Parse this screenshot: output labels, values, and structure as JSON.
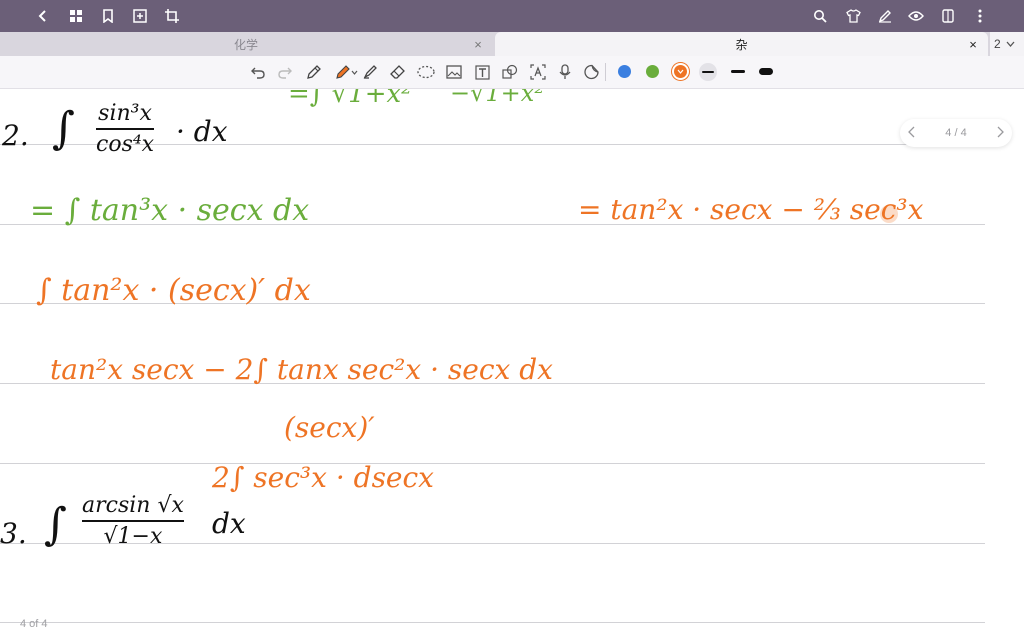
{
  "colors": {
    "topbar": "#6b5f78",
    "ink_black": "#111111",
    "ink_green": "#6aad3c",
    "ink_orange": "#ee7425",
    "swatch_blue": "#3b7fe0",
    "swatch_green": "#6aad3c",
    "swatch_orange": "#ee7425"
  },
  "topbar": {
    "left_icons": [
      "back-icon",
      "grid-icon",
      "bookmark-icon",
      "add-page-icon",
      "crop-icon"
    ],
    "right_icons": [
      "search-icon",
      "shirt-icon",
      "pen-settings-icon",
      "eye-icon",
      "tablet-icon",
      "more-icon"
    ]
  },
  "tabs": [
    {
      "label": "化学",
      "active": false,
      "close": "×"
    },
    {
      "label": "杂",
      "active": true,
      "close": "×"
    }
  ],
  "tab_count": "2",
  "toolbar": {
    "tools": [
      "undo-icon",
      "redo-icon",
      "pen-icon",
      "highlighter-icon",
      "brush-icon",
      "eraser-icon",
      "lasso-icon",
      "image-icon",
      "text-icon",
      "shape-icon",
      "ocr-icon",
      "mic-icon",
      "sticker-icon"
    ],
    "active_color": "orange",
    "stroke_widths": [
      "thin",
      "medium",
      "thick"
    ]
  },
  "page": {
    "pager_text": "4 / 4",
    "footer": "4 of 4"
  },
  "handwriting": {
    "top_green_partial_1": "=∫ √1+x²",
    "top_green_partial_2": "−√1+x²",
    "problem2_number": "2.",
    "problem2_numerator": "sin³x",
    "problem2_denominator": "cos⁴x",
    "problem2_dx": "· dx",
    "green_line": "= ∫ tan³x · secx dx",
    "orange_line1": "∫ tan²x · (secx)′ dx",
    "orange_line2": "tan²x secx − 2∫ tanx sec²x · secx dx",
    "orange_line3": "(secx)′",
    "orange_line4": "2∫ sec³x · dsecx",
    "orange_result": "= tan²x · secx − ⅔ sec³x",
    "problem3_number": "3.",
    "problem3_numerator": "arcsin √x",
    "problem3_denominator": "√1−x",
    "problem3_dx": "dx"
  }
}
